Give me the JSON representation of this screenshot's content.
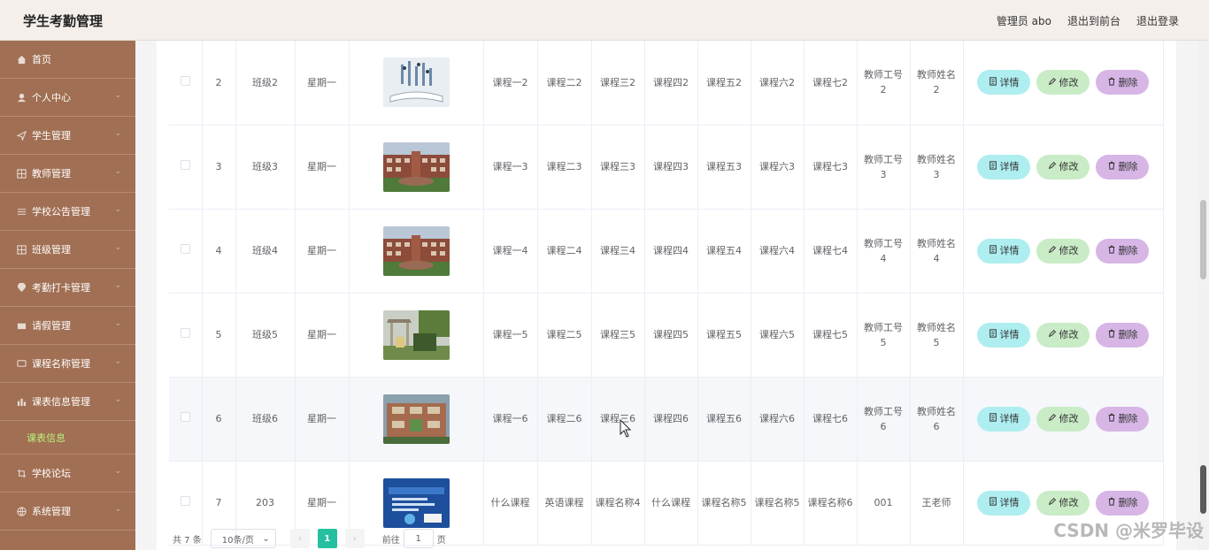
{
  "app": {
    "title": "学生考勤管理"
  },
  "header": {
    "admin": "管理员 abo",
    "front": "退出到前台",
    "logout": "退出登录"
  },
  "sidebar": {
    "items": [
      {
        "label": "首页",
        "icon": "home-icon",
        "chevron": false
      },
      {
        "label": "个人中心",
        "icon": "user-icon",
        "chevron": true
      },
      {
        "label": "学生管理",
        "icon": "send-icon",
        "chevron": true
      },
      {
        "label": "教师管理",
        "icon": "grid-icon",
        "chevron": true
      },
      {
        "label": "学校公告管理",
        "icon": "sliders-icon",
        "chevron": true
      },
      {
        "label": "班级管理",
        "icon": "grid-icon",
        "chevron": true
      },
      {
        "label": "考勤打卡管理",
        "icon": "location-icon",
        "chevron": true
      },
      {
        "label": "请假管理",
        "icon": "ticket-icon",
        "chevron": true
      },
      {
        "label": "课程名称管理",
        "icon": "chat-icon",
        "chevron": true
      },
      {
        "label": "课表信息管理",
        "icon": "chart-icon",
        "chevron": true
      }
    ],
    "sub_active": "课表信息",
    "items_after": [
      {
        "label": "学校论坛",
        "icon": "crop-icon",
        "chevron": true
      },
      {
        "label": "系统管理",
        "icon": "globe-icon",
        "chevron": true
      }
    ]
  },
  "table": {
    "rows": [
      {
        "id": "2",
        "class": "班级2",
        "day": "星期一",
        "image": "book-image",
        "c1": "课程一2",
        "c2": "课程二2",
        "c3": "课程三2",
        "c4": "课程四2",
        "c5": "课程五2",
        "c6": "课程六2",
        "c7": "课程七2",
        "tno": [
          "教师工号",
          "2"
        ],
        "tname": [
          "教师姓名",
          "2"
        ],
        "hl": false
      },
      {
        "id": "3",
        "class": "班级3",
        "day": "星期一",
        "image": "school-image",
        "c1": "课程一3",
        "c2": "课程二3",
        "c3": "课程三3",
        "c4": "课程四3",
        "c5": "课程五3",
        "c6": "课程六3",
        "c7": "课程七3",
        "tno": [
          "教师工号",
          "3"
        ],
        "tname": [
          "教师姓名",
          "3"
        ],
        "hl": false
      },
      {
        "id": "4",
        "class": "班级4",
        "day": "星期一",
        "image": "school-image",
        "c1": "课程一4",
        "c2": "课程二4",
        "c3": "课程三4",
        "c4": "课程四4",
        "c5": "课程五4",
        "c6": "课程六4",
        "c7": "课程七4",
        "tno": [
          "教师工号",
          "4"
        ],
        "tname": [
          "教师姓名",
          "4"
        ],
        "hl": false
      },
      {
        "id": "5",
        "class": "班级5",
        "day": "星期一",
        "image": "gate-image",
        "c1": "课程一5",
        "c2": "课程二5",
        "c3": "课程三5",
        "c4": "课程四5",
        "c5": "课程五5",
        "c6": "课程六5",
        "c7": "课程七5",
        "tno": [
          "教师工号",
          "5"
        ],
        "tname": [
          "教师姓名",
          "5"
        ],
        "hl": false
      },
      {
        "id": "6",
        "class": "班级6",
        "day": "星期一",
        "image": "campus-image",
        "c1": "课程一6",
        "c2": "课程二6",
        "c3": "课程三6",
        "c4": "课程四6",
        "c5": "课程五6",
        "c6": "课程六6",
        "c7": "课程七6",
        "tno": [
          "教师工号",
          "6"
        ],
        "tname": [
          "教师姓名",
          "6"
        ],
        "hl": true
      },
      {
        "id": "7",
        "class": "203",
        "day": "星期一",
        "image": "cover-image",
        "c1": "什么课程",
        "c2": "英语课程",
        "c3": "课程名称4",
        "c4": "什么课程",
        "c5": "课程名称5",
        "c6": "课程名称5",
        "c7": "课程名称6",
        "tno": [
          "001"
        ],
        "tname": [
          "王老师"
        ],
        "hl": false
      }
    ],
    "actions": {
      "detail": "详情",
      "edit": "修改",
      "delete": "删除"
    }
  },
  "pager": {
    "total": "共 7 条",
    "size": "10条/页",
    "current": "1",
    "goto": "前往",
    "goto_value": "1",
    "page_unit": "页"
  },
  "watermark": "CSDN @米罗毕设",
  "colors": {
    "sidebar": "#a16f53",
    "accent": "#26c0a0",
    "detail": "#aeeef0",
    "edit": "#c9ecc6",
    "delete": "#d7b6e6"
  }
}
